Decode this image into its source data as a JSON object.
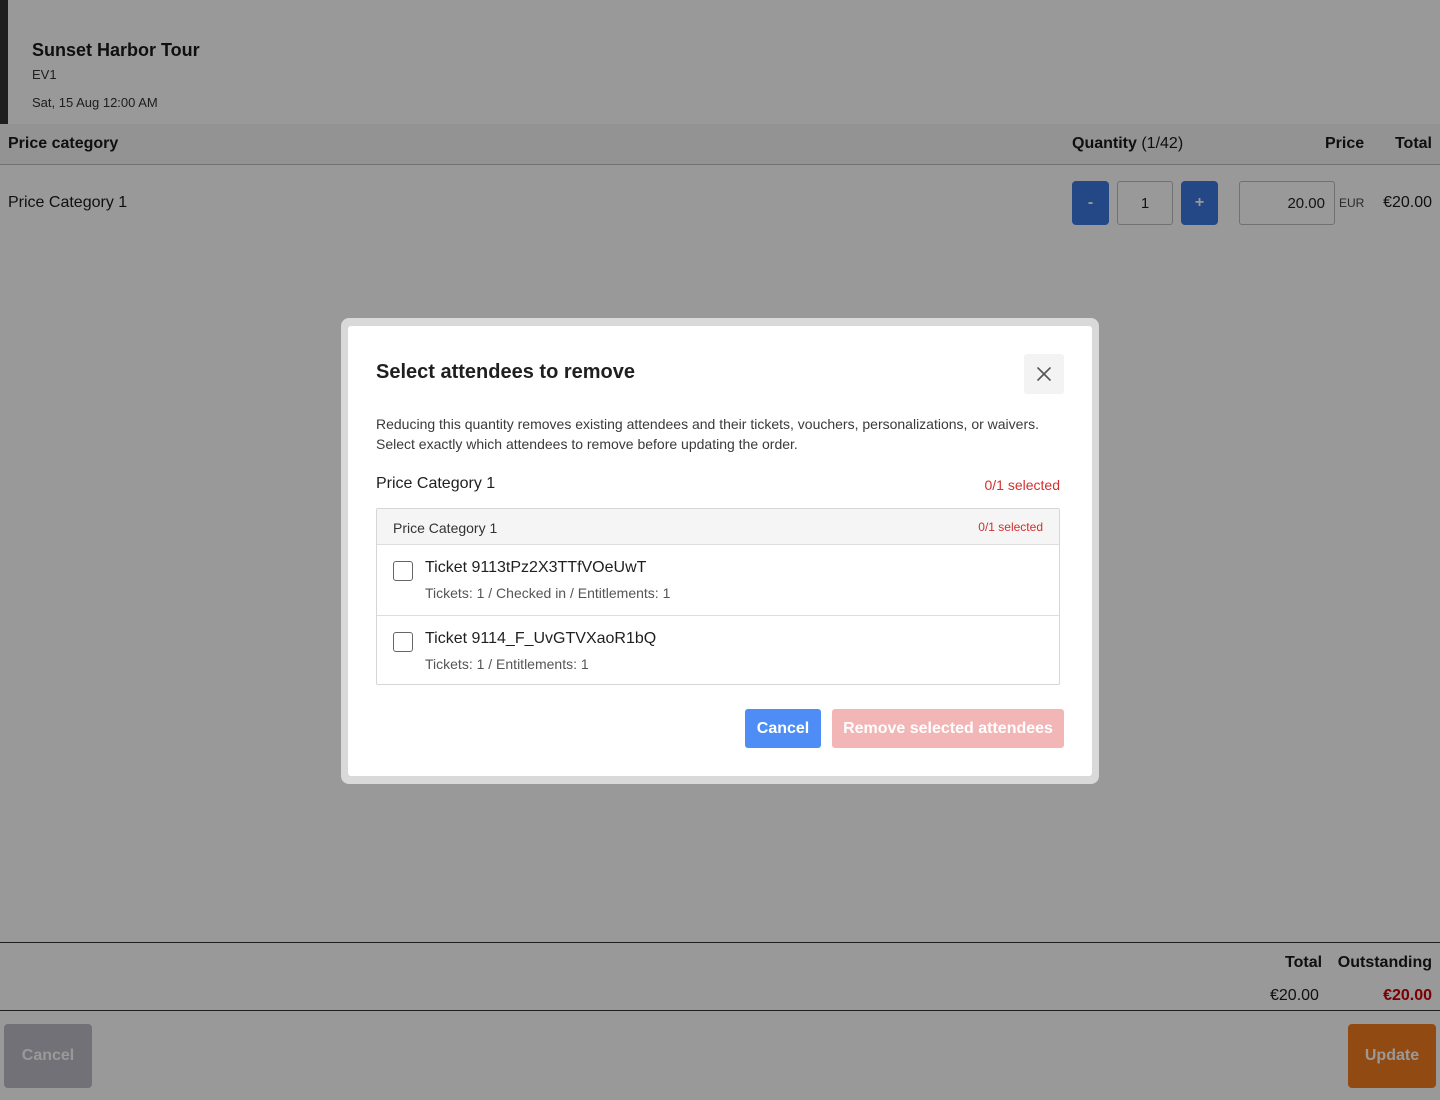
{
  "event": {
    "title": "Sunset Harbor Tour",
    "code": "EV1",
    "date": "Sat, 15 Aug 12:00 AM"
  },
  "table": {
    "headers": {
      "price_category": "Price category",
      "quantity": "Quantity",
      "quantity_count": "(1/42)",
      "price": "Price",
      "total": "Total"
    },
    "row": {
      "label": "Price Category 1",
      "decrement_label": "-",
      "increment_label": "+",
      "quantity": "1",
      "price": "20.00",
      "currency": "EUR",
      "total": "€20.00"
    }
  },
  "summary": {
    "total_label": "Total",
    "outstanding_label": "Outstanding",
    "total_value": "€20.00",
    "outstanding_value": "€20.00"
  },
  "footer": {
    "cancel_label": "Cancel",
    "update_label": "Update"
  },
  "modal": {
    "title": "Select attendees to remove",
    "description_line1": "Reducing this quantity removes existing attendees and their tickets, vouchers, personalizations, or waivers.",
    "description_line2": "Select exactly which attendees to remove before updating the order.",
    "section_label": "Price Category 1",
    "section_count": "0/1 selected",
    "box_label": "Price Category 1",
    "box_count": "0/1 selected",
    "attendees": [
      {
        "name": "Ticket 9113tPz2X3TTfVOeUwT",
        "meta": "Tickets: 1 / Checked in / Entitlements: 1"
      },
      {
        "name": "Ticket 9114_F_UvGTVXaoR1bQ",
        "meta": "Tickets: 1 / Entitlements: 1"
      }
    ],
    "cancel_label": "Cancel",
    "remove_label": "Remove selected attendees"
  },
  "colors": {
    "primary_blue": "#3d77e0",
    "update_orange": "#f07c1f",
    "danger_red": "#d32f2f",
    "remove_disabled": "#f3b6b6"
  },
  "icons": {
    "close": "close-icon"
  }
}
